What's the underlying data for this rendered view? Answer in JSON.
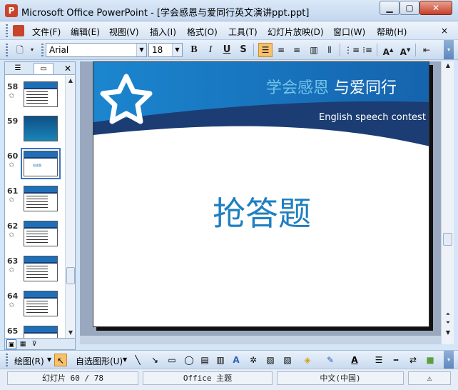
{
  "window": {
    "title": "Microsoft Office PowerPoint - [学会感恩与爱同行英文演讲ppt.ppt]"
  },
  "menubar": {
    "items": [
      "文件(F)",
      "编辑(E)",
      "视图(V)",
      "插入(I)",
      "格式(O)",
      "工具(T)",
      "幻灯片放映(D)",
      "窗口(W)",
      "帮助(H)"
    ],
    "close": "×"
  },
  "toolbar": {
    "font": "Arial",
    "size": "18"
  },
  "slides_panel": {
    "slides": [
      {
        "num": "58",
        "icon": "✩"
      },
      {
        "num": "59",
        "icon": ""
      },
      {
        "num": "60",
        "icon": "✩",
        "caption": "抢答题"
      },
      {
        "num": "61",
        "icon": "✩"
      },
      {
        "num": "62",
        "icon": "✩"
      },
      {
        "num": "63",
        "icon": "✩"
      },
      {
        "num": "64",
        "icon": "✩"
      },
      {
        "num": "65",
        "icon": ""
      }
    ],
    "selected": "60"
  },
  "slide": {
    "title_cn_light": "学会感恩",
    "title_cn_bold": "与爱同行",
    "subtitle": "English speech contest",
    "main_text": "抢答题",
    "colors": {
      "band_top": "#1f78c0",
      "band_dark": "#1b3d73",
      "title_light": "#72c3e8",
      "main": "#1f7fc1"
    }
  },
  "drawbar": {
    "draw_label": "绘图(R)",
    "autoshape_label": "自选图形(U)"
  },
  "statusbar": {
    "slide_info": "幻灯片 60 / 78",
    "design": "Office 主题",
    "language": "中文(中国)"
  }
}
